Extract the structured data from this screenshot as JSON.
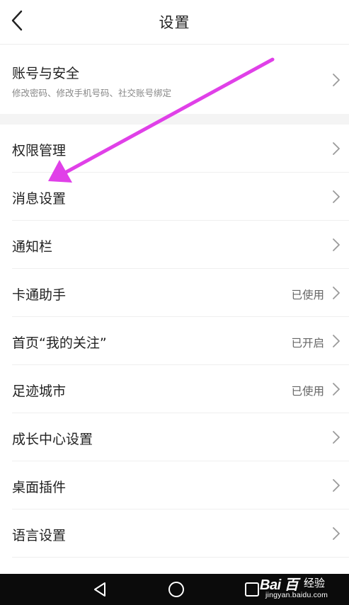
{
  "header": {
    "title": "设置",
    "back_icon": "chevron-left-icon"
  },
  "account": {
    "title": "账号与安全",
    "subtitle": "修改密码、修改手机号码、社交账号绑定"
  },
  "settings": [
    {
      "label": "权限管理",
      "status": ""
    },
    {
      "label": "消息设置",
      "status": ""
    },
    {
      "label": "通知栏",
      "status": ""
    },
    {
      "label": "卡通助手",
      "status": "已使用"
    },
    {
      "label": "首页“我的关注”",
      "status": "已开启"
    },
    {
      "label": "足迹城市",
      "status": "已使用"
    },
    {
      "label": "成长中心设置",
      "status": ""
    },
    {
      "label": "桌面插件",
      "status": ""
    },
    {
      "label": "语言设置",
      "status": ""
    }
  ],
  "annotation": {
    "color": "#e040e8"
  },
  "navbar": {
    "icons": [
      "triangle-back-icon",
      "circle-home-icon",
      "square-recent-icon"
    ]
  },
  "watermark": {
    "logo": "Bai 百",
    "text": "经验",
    "url": "jingyan.baidu.com"
  }
}
